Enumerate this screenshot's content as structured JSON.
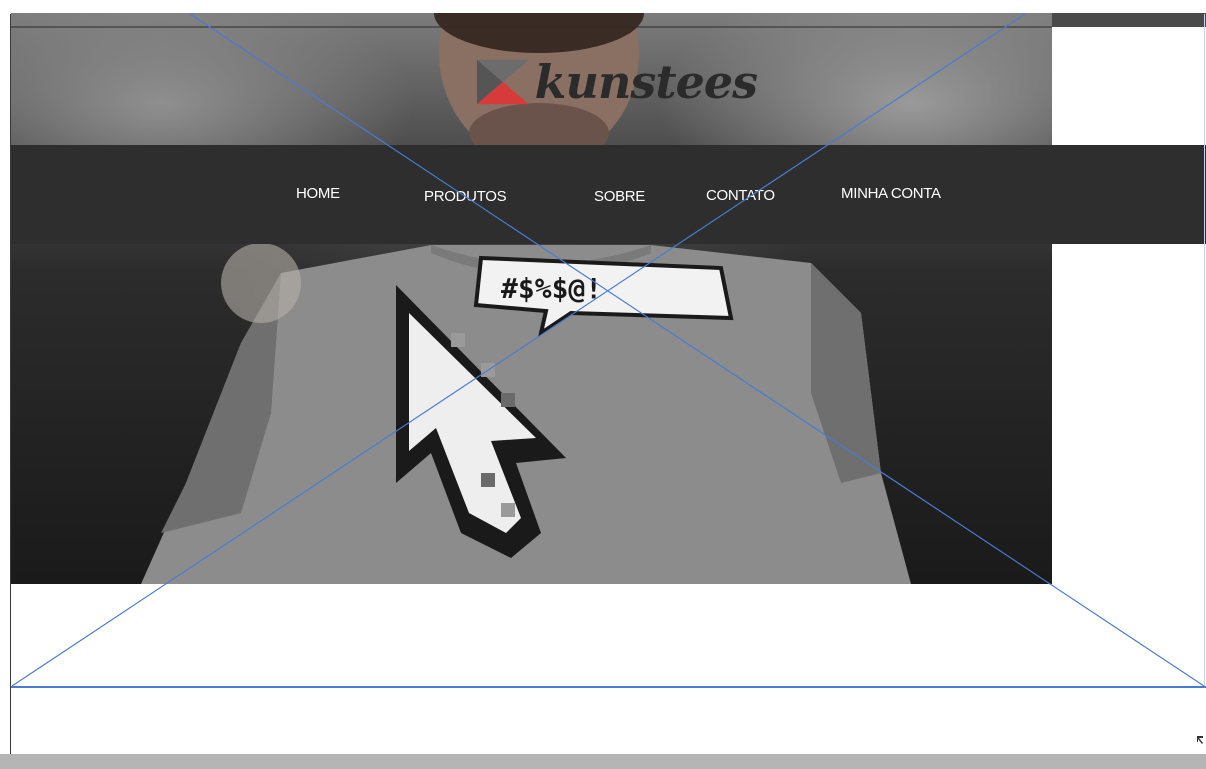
{
  "header": {
    "logo_text": "kunstees",
    "logo_icon": "kunstees-logo-mark"
  },
  "nav": {
    "items": [
      {
        "label": "HOME"
      },
      {
        "label": "PRODUTOS"
      },
      {
        "label": "SOBRE"
      },
      {
        "label": "CONTATO"
      },
      {
        "label": "MINHA CONTA"
      }
    ]
  },
  "hero": {
    "image_description_icon": "tshirt-cursor-photo",
    "shirt_bubble_text": "#$%$@!"
  },
  "colors": {
    "navbar": "#2e2e2e",
    "nav_text": "#ffffff",
    "logo_text": "#2b2b2b",
    "logo_red": "#d63a3a",
    "logo_gray": "#555555",
    "guide_line": "#4a7bd0",
    "bottom_bar": "#b5b5b5"
  }
}
